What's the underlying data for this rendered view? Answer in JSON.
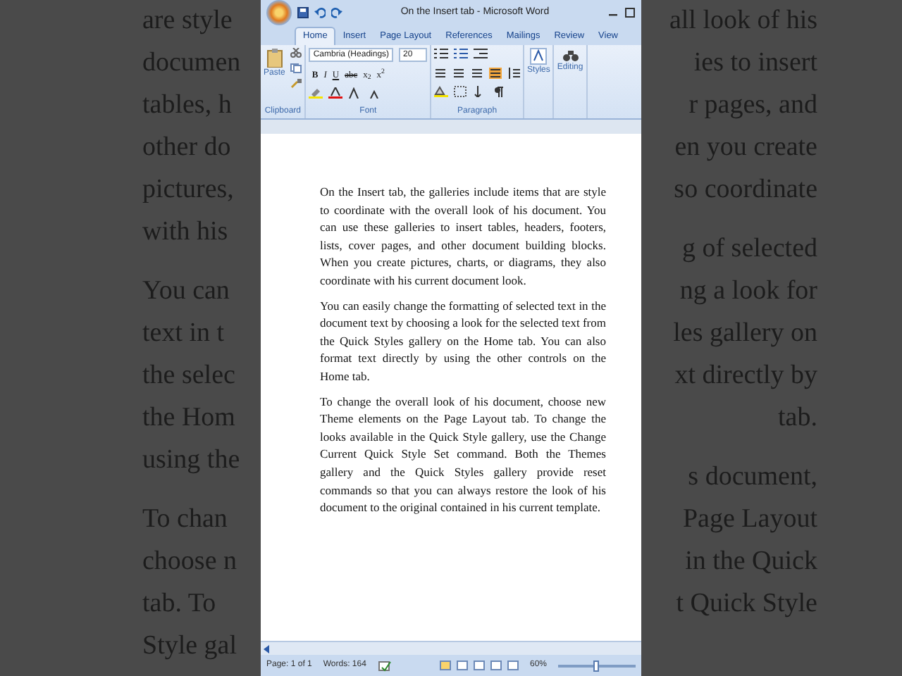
{
  "background_text": {
    "left_paragraphs": [
      [
        "are style",
        "documen",
        "tables, h",
        "other do",
        "pictures,",
        "with his"
      ],
      [
        "You can",
        "text in t",
        "the selec",
        "the Hom",
        "using the"
      ],
      [
        "To chan",
        "choose n",
        "tab. To",
        "Style gal"
      ]
    ],
    "right_paragraphs": [
      [
        "all look of his",
        "ies to insert",
        "r pages, and",
        "en you create",
        "so coordinate"
      ],
      [
        "g of selected",
        "ng a look for",
        "les gallery on",
        "xt directly by",
        "tab."
      ],
      [
        "s document,",
        "Page Layout",
        "in the Quick",
        "t Quick Style"
      ]
    ]
  },
  "window": {
    "title": "On the Insert tab - Microsoft Word"
  },
  "tabs": [
    {
      "label": "Home",
      "selected": true
    },
    {
      "label": "Insert",
      "selected": false
    },
    {
      "label": "Page Layout",
      "selected": false
    },
    {
      "label": "References",
      "selected": false
    },
    {
      "label": "Mailings",
      "selected": false
    },
    {
      "label": "Review",
      "selected": false
    },
    {
      "label": "View",
      "selected": false
    }
  ],
  "ribbon": {
    "clipboard": {
      "paste_label": "Paste",
      "group_label": "Clipboard"
    },
    "font": {
      "font_name": "Cambria (Headings)",
      "font_size": "20",
      "format_buttons": [
        "B",
        "I",
        "U",
        "abc",
        "x$_{2}$",
        "x$^{2}$"
      ],
      "group_label": "Font"
    },
    "paragraph": {
      "alignments": [
        {
          "selected": false
        },
        {
          "selected": false
        },
        {
          "selected": false
        },
        {
          "selected": true
        }
      ],
      "group_label": "Paragraph"
    },
    "styles_label": "Styles",
    "editing_label": "Editing"
  },
  "document": {
    "paragraphs": [
      "On the Insert tab, the galleries include items that are style to coordinate with the overall look of his document. You can use these galleries to insert tables, headers, footers, lists, cover pages, and other document building blocks. When you create pictures, charts, or diagrams, they also coordinate with his current document look.",
      "You can easily change the formatting of selected text in the document text by choosing a look for the selected text from the Quick Styles gallery on the Home tab. You can also format text directly by using the other controls on the Home tab.",
      "To change the overall look of his document, choose new Theme elements on the Page Layout tab. To change the looks available in the Quick Style gallery, use the Change Current Quick Style Set command. Both the Themes gallery and the Quick Styles gallery provide reset commands so that you can always restore the look of his document to the original contained in his current template."
    ]
  },
  "status_bar": {
    "page": "Page: 1 of 1",
    "words": "Words: 164",
    "zoom": "60%",
    "zoom_slider": {
      "level": 0.45
    }
  }
}
